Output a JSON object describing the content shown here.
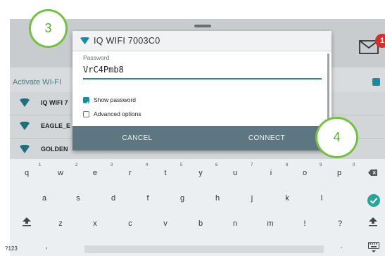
{
  "background": {
    "activate_label": "Activate WI-FI",
    "notification_count": "1",
    "networks": [
      {
        "name": "IQ WIFI 7"
      },
      {
        "name": "EAGLE_E"
      },
      {
        "name": "GOLDEN"
      }
    ]
  },
  "dialog": {
    "title": "IQ WIFI 7003C0",
    "password_label": "Password",
    "password_value": "VrC4Pmb8",
    "show_password_label": "Show password",
    "show_password_checked": true,
    "advanced_options_label": "Advanced options",
    "advanced_options_checked": false,
    "cancel_label": "CANCEL",
    "connect_label": "CONNECT"
  },
  "callouts": {
    "step_a": "3",
    "step_b": "4"
  },
  "keyboard": {
    "row1": [
      "q",
      "w",
      "e",
      "r",
      "t",
      "y",
      "u",
      "i",
      "o",
      "p"
    ],
    "row1_numbers": [
      "1",
      "2",
      "3",
      "4",
      "5",
      "6",
      "7",
      "8",
      "9",
      "0"
    ],
    "row2": [
      "a",
      "s",
      "d",
      "f",
      "g",
      "h",
      "j",
      "k",
      "l"
    ],
    "row3": [
      "z",
      "x",
      "c",
      "v",
      "b",
      "n",
      "m",
      "!",
      "?"
    ],
    "symbols_label": "?123",
    "comma": ",",
    "period": "."
  },
  "colors": {
    "accent": "#1a8aa3",
    "callout": "#74c043",
    "button_bar": "#5e7682"
  }
}
